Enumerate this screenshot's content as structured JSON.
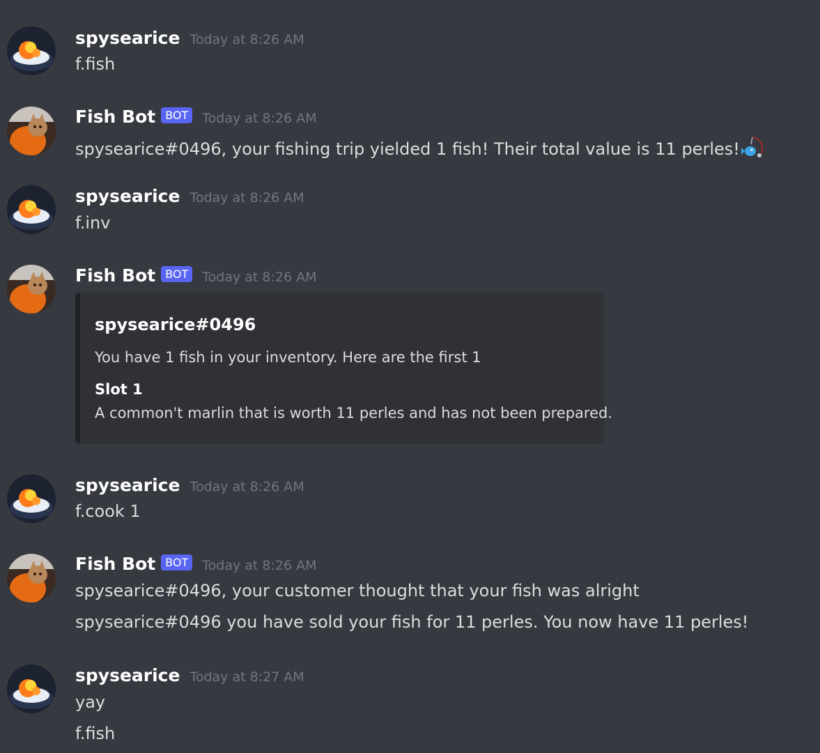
{
  "users": {
    "user": {
      "name": "spysearice"
    },
    "bot": {
      "name": "Fish Bot",
      "tag": "BOT"
    }
  },
  "messages": [
    {
      "author": "spysearice",
      "time": "Today at 8:26 AM",
      "lines": [
        "f.fish"
      ]
    },
    {
      "author": "Fish Bot",
      "time": "Today at 8:26 AM",
      "lines": [
        "spysearice#0496, your fishing trip yielded 1 fish! Their total value is 11 perles!"
      ],
      "emoji": "fishing-pole-emoji"
    },
    {
      "author": "spysearice",
      "time": "Today at 8:26 AM",
      "lines": [
        "f.inv"
      ]
    },
    {
      "author": "Fish Bot",
      "time": "Today at 8:26 AM",
      "embed": {
        "title": "spysearice#0496",
        "description": "You have 1 fish in your inventory. Here are the first 1",
        "field_name": "Slot 1",
        "field_value": "A common't marlin that is worth 11 perles and has not been prepared."
      }
    },
    {
      "author": "spysearice",
      "time": "Today at 8:26 AM",
      "lines": [
        "f.cook 1"
      ]
    },
    {
      "author": "Fish Bot",
      "time": "Today at 8:26 AM",
      "lines": [
        "spysearice#0496, your customer thought that your fish was alright",
        "spysearice#0496 you have sold your fish for 11 perles. You now have 11 perles!"
      ]
    },
    {
      "author": "spysearice",
      "time": "Today at 8:27 AM",
      "lines": [
        "yay",
        "f.fish"
      ]
    }
  ],
  "colors": {
    "background": "#36393f",
    "embed_background": "#2f3136",
    "bot_tag": "#5865f2",
    "timestamp": "#72767d",
    "text": "#dcddde"
  }
}
